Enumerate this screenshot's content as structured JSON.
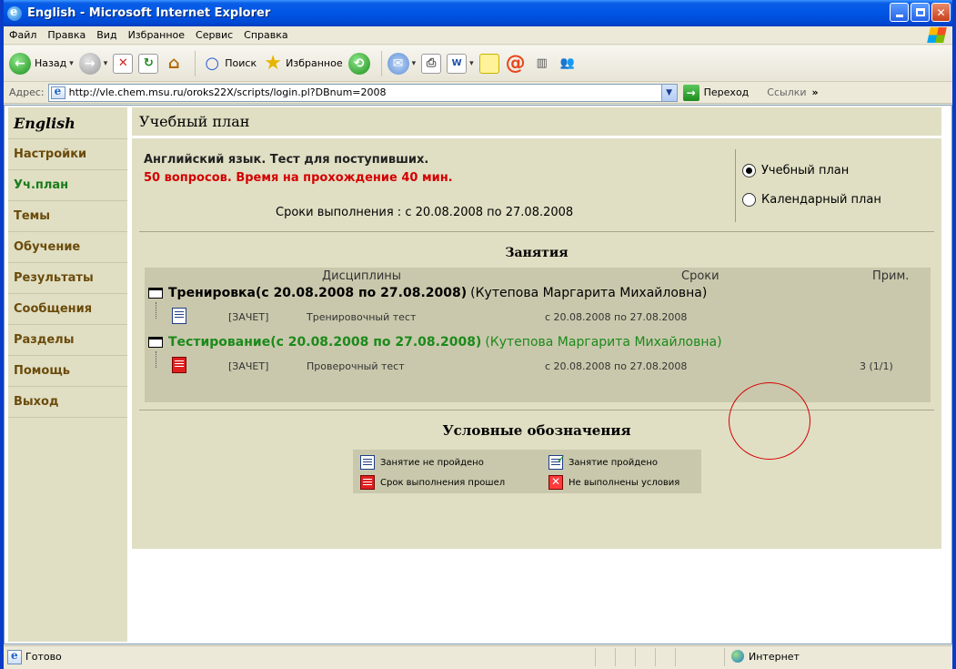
{
  "window": {
    "title": "English - Microsoft Internet Explorer"
  },
  "menu": [
    "Файл",
    "Правка",
    "Вид",
    "Избранное",
    "Сервис",
    "Справка"
  ],
  "toolbar": {
    "back_label": "Назад",
    "search_label": "Поиск",
    "favorites_label": "Избранное"
  },
  "address": {
    "label": "Адрес:",
    "url": "http://vle.chem.msu.ru/oroks22X/scripts/login.pl?DBnum=2008",
    "go_label": "Переход",
    "links_label": "Ссылки",
    "chevron": "»"
  },
  "sidebar": {
    "header": "English",
    "items": [
      {
        "label": "Настройки"
      },
      {
        "label": "Уч.план"
      },
      {
        "label": "Темы"
      },
      {
        "label": "Обучение"
      },
      {
        "label": "Результаты"
      },
      {
        "label": "Сообщения"
      },
      {
        "label": "Разделы"
      },
      {
        "label": "Помощь"
      },
      {
        "label": "Выход"
      }
    ],
    "active_index": 1
  },
  "main": {
    "header": "Учебный план",
    "course_title": "Английский язык. Тест для поступивших.",
    "course_subtitle": "50 вопросов. Время на прохождение 40 мин.",
    "deadline": "Сроки выполнения : с 20.08.2008 по 27.08.2008",
    "view_options": [
      {
        "label": "Учебный план",
        "selected": true
      },
      {
        "label": "Календарный план",
        "selected": false
      }
    ],
    "lessons_title": "Занятия",
    "columns": {
      "disciplines": "Дисциплины",
      "dates": "Сроки",
      "notes": "Прим."
    },
    "groups": [
      {
        "title": "Тренировка(с 20.08.2008 по 27.08.2008)",
        "teacher": "(Кутепова Маргарита Михайловна)",
        "color": "#000000",
        "row": {
          "type": "[ЗАЧЕТ]",
          "name": "Тренировочный тест",
          "dates": "с 20.08.2008 по 27.08.2008",
          "note": ""
        }
      },
      {
        "title": "Тестирование(с 20.08.2008 по 27.08.2008)",
        "teacher": "(Кутепова Маргарита Михайловна)",
        "color": "#1b8a1b",
        "row": {
          "type": "[ЗАЧЕТ]",
          "name": "Проверочный тест",
          "dates": "с 20.08.2008 по 27.08.2008",
          "note": "3 (1/1)"
        }
      }
    ],
    "legend_title": "Условные обозначения",
    "legend": [
      {
        "label": "Занятие не пройдено",
        "icon": "not-passed-icon"
      },
      {
        "label": "Занятие пройдено",
        "icon": "passed-icon"
      },
      {
        "label": "Срок выполнения прошел",
        "icon": "deadline-passed-icon"
      },
      {
        "label": "Не выполнены условия",
        "icon": "conditions-failed-icon"
      }
    ]
  },
  "status": {
    "text": "Готово",
    "zone": "Интернет"
  }
}
